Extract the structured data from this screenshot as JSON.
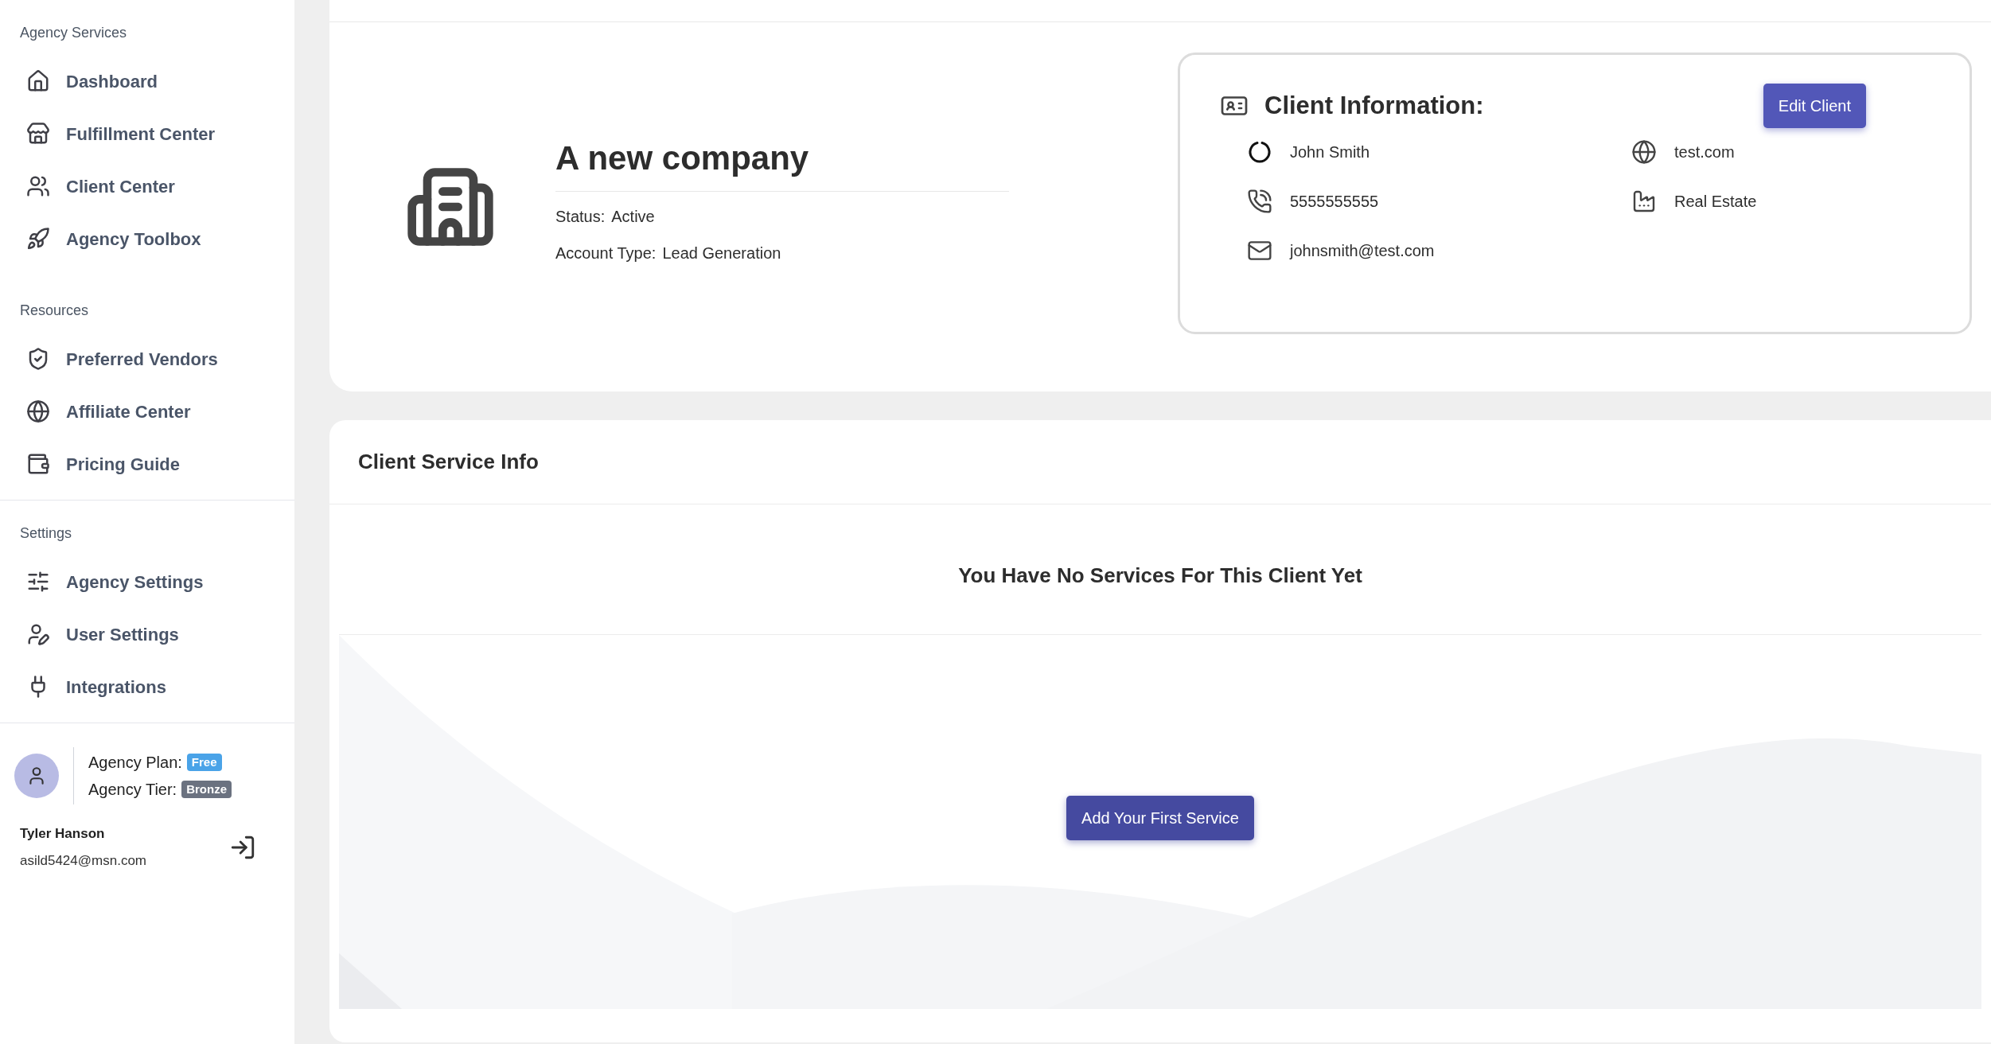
{
  "sidebar": {
    "sections": [
      {
        "heading": "Agency Services",
        "items": [
          {
            "label": "Dashboard"
          },
          {
            "label": "Fulfillment Center"
          },
          {
            "label": "Client Center"
          },
          {
            "label": "Agency Toolbox"
          }
        ]
      },
      {
        "heading": "Resources",
        "items": [
          {
            "label": "Preferred Vendors"
          },
          {
            "label": "Affiliate Center"
          },
          {
            "label": "Pricing Guide"
          }
        ]
      },
      {
        "heading": "Settings",
        "items": [
          {
            "label": "Agency Settings"
          },
          {
            "label": "User Settings"
          },
          {
            "label": "Integrations"
          }
        ]
      }
    ],
    "profile": {
      "plan_label": "Agency Plan:",
      "plan": "Free",
      "tier_label": "Agency Tier:",
      "tier": "Bronze",
      "name": "Tyler Hanson",
      "email": "asild5424@msn.com"
    }
  },
  "company": {
    "name": "A new company",
    "fields": [
      {
        "label": "Status:",
        "value": "Active"
      },
      {
        "label": "Account Type:",
        "value": "Lead Generation"
      }
    ]
  },
  "client_info": {
    "title": "Client Information:",
    "edit_button": "Edit Client",
    "fields": [
      {
        "value": "John Smith"
      },
      {
        "value": "test.com"
      },
      {
        "value": "5555555555"
      },
      {
        "value": "Real Estate"
      },
      {
        "value": "johnsmith@test.com"
      }
    ]
  },
  "service_info": {
    "title": "Client Service Info",
    "empty_message": "You Have No Services For This Client Yet",
    "add_button": "Add Your First Service"
  }
}
